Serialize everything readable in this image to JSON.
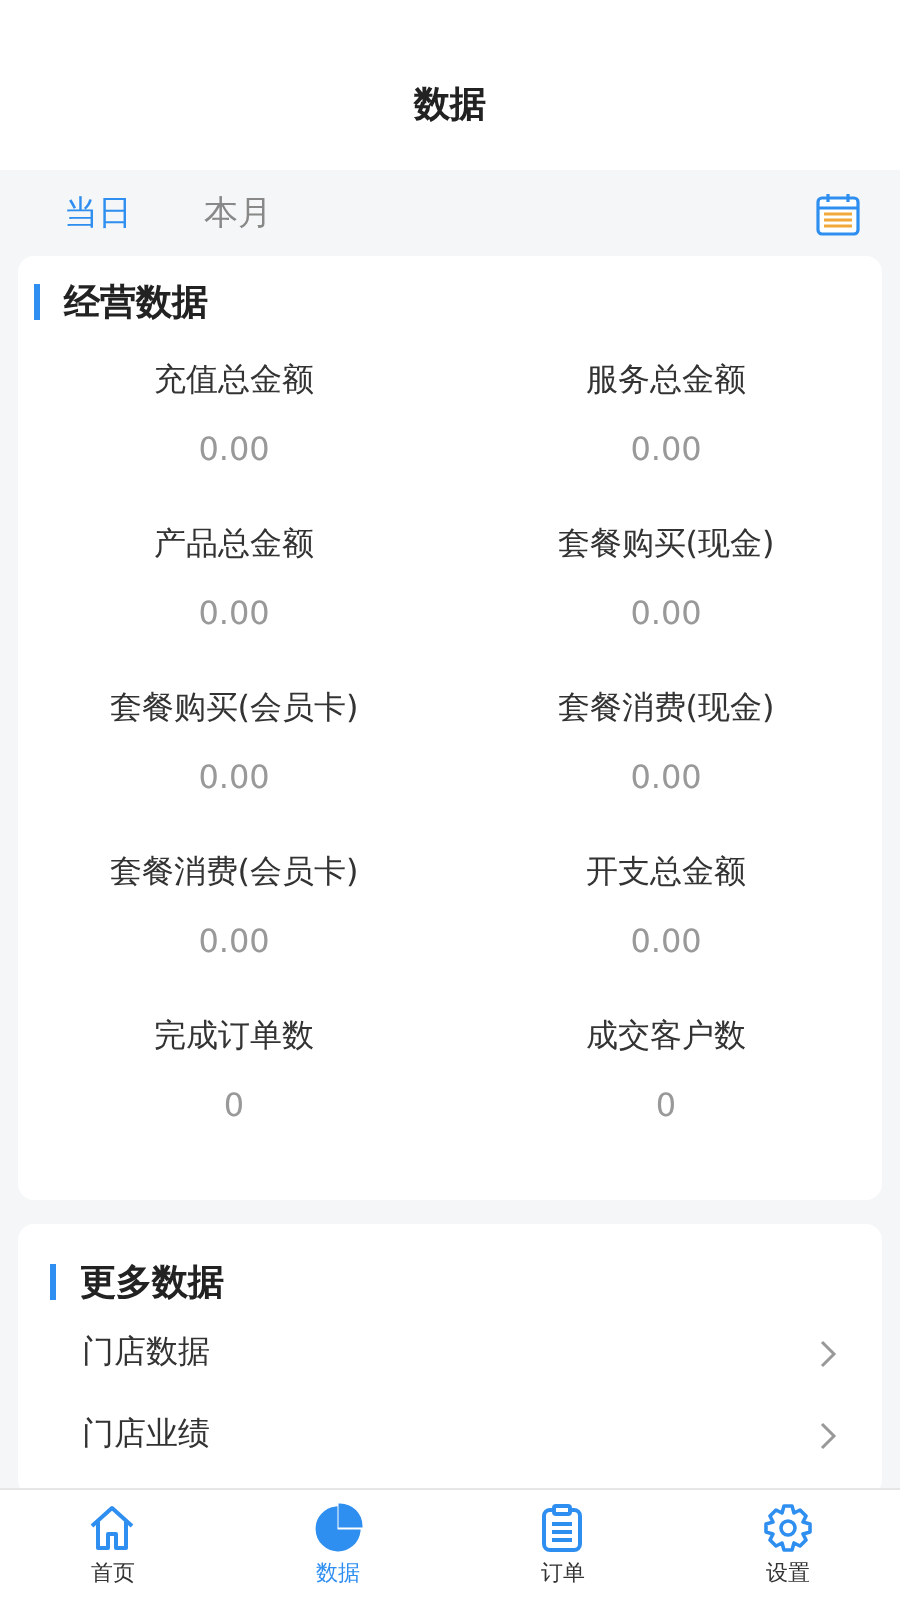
{
  "header": {
    "title": "数据"
  },
  "periods": [
    {
      "label": "当日",
      "selected": true
    },
    {
      "label": "本月",
      "selected": false
    }
  ],
  "business": {
    "title": "经营数据",
    "metrics": [
      {
        "label": "充值总金额",
        "value": "0.00"
      },
      {
        "label": "服务总金额",
        "value": "0.00"
      },
      {
        "label": "产品总金额",
        "value": "0.00"
      },
      {
        "label": "套餐购买(现金)",
        "value": "0.00"
      },
      {
        "label": "套餐购买(会员卡)",
        "value": "0.00"
      },
      {
        "label": "套餐消费(现金)",
        "value": "0.00"
      },
      {
        "label": "套餐消费(会员卡)",
        "value": "0.00"
      },
      {
        "label": "开支总金额",
        "value": "0.00"
      },
      {
        "label": "完成订单数",
        "value": "0"
      },
      {
        "label": "成交客户数",
        "value": "0"
      }
    ]
  },
  "more": {
    "title": "更多数据",
    "items": [
      {
        "label": "门店数据"
      },
      {
        "label": "门店业绩"
      }
    ]
  },
  "tabbar": [
    {
      "label": "首页",
      "kind": "home",
      "selected": false
    },
    {
      "label": "数据",
      "kind": "chart",
      "selected": true
    },
    {
      "label": "订单",
      "kind": "orders",
      "selected": false
    },
    {
      "label": "设置",
      "kind": "settings",
      "selected": false
    }
  ]
}
